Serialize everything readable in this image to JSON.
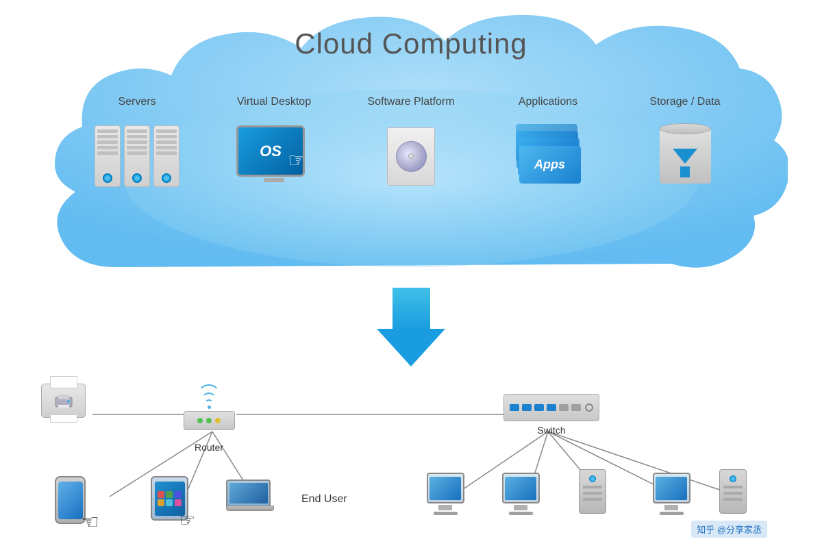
{
  "title": "Cloud Computing",
  "cloud": {
    "title": "Cloud Computing",
    "items": [
      {
        "id": "servers",
        "label": "Servers"
      },
      {
        "id": "virtual-desktop",
        "label": "Virtual Desktop"
      },
      {
        "id": "software-platform",
        "label": "Software Platform"
      },
      {
        "id": "applications",
        "label": "Applications"
      },
      {
        "id": "storage-data",
        "label": "Storage / Data"
      }
    ]
  },
  "network": {
    "router_label": "Router",
    "switch_label": "Switch",
    "end_user_label": "End User"
  },
  "apps_text": "Apps",
  "os_text": "OS",
  "watermark": "知乎 @分享家丞"
}
